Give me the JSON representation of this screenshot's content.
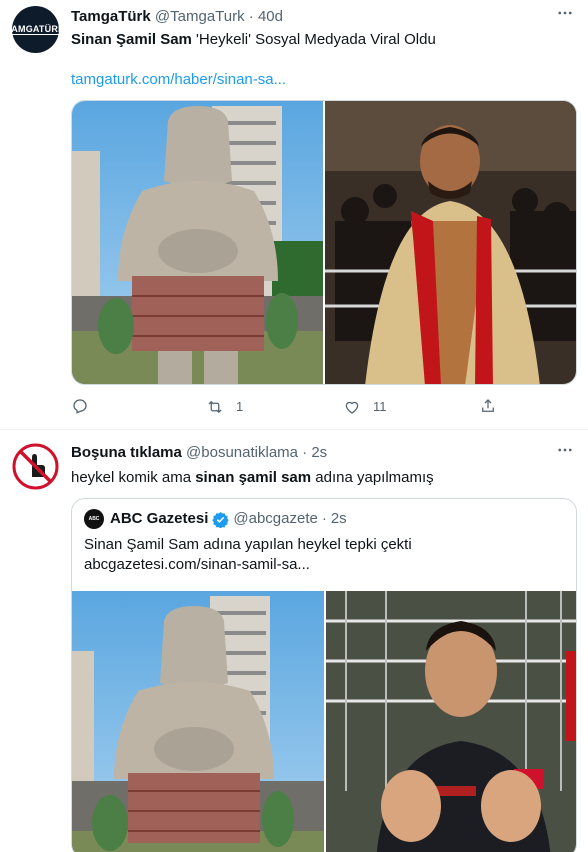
{
  "tweets": [
    {
      "author_name": "TamgaTürk",
      "handle": "@TamgaTurk",
      "separator": "·",
      "time": "40d",
      "avatar_text": "TAMGATÜRK",
      "text_bold": "Sinan Şamil Sam",
      "text_rest": " 'Heykeli' Sosyal Medyada Viral Oldu",
      "link": "tamgaturk.com/haber/sinan-sa...",
      "retweet_count": "1",
      "like_count": "11",
      "images": [
        "statue-photo",
        "boxer-in-robe-photo"
      ]
    },
    {
      "author_name": "Boşuna tıklama",
      "handle": "@bosunatiklama",
      "separator": "·",
      "time": "2s",
      "text_pre": "heykel komik ama ",
      "text_bold": "sinan şamil sam",
      "text_post": " adına yapılmamış",
      "quote": {
        "author_name": "ABC Gazetesi",
        "handle": "@abcgazete",
        "separator": "·",
        "time": "2s",
        "avatar_text": "ABC",
        "text": "Sinan Şamil Sam adına yapılan heykel tepki çekti abcgazetesi.com/sinan-samil-sa...",
        "images": [
          "statue-photo",
          "boxer-with-gloves-photo"
        ]
      }
    }
  ],
  "colors": {
    "link": "#1d9bf0",
    "muted": "#536471",
    "border": "#cfd9de",
    "verified": "#1d9bf0",
    "no_sign": "#d0112b"
  },
  "icons": [
    "reply-icon",
    "retweet-icon",
    "like-icon",
    "share-icon",
    "more-icon",
    "verified-badge-icon"
  ]
}
